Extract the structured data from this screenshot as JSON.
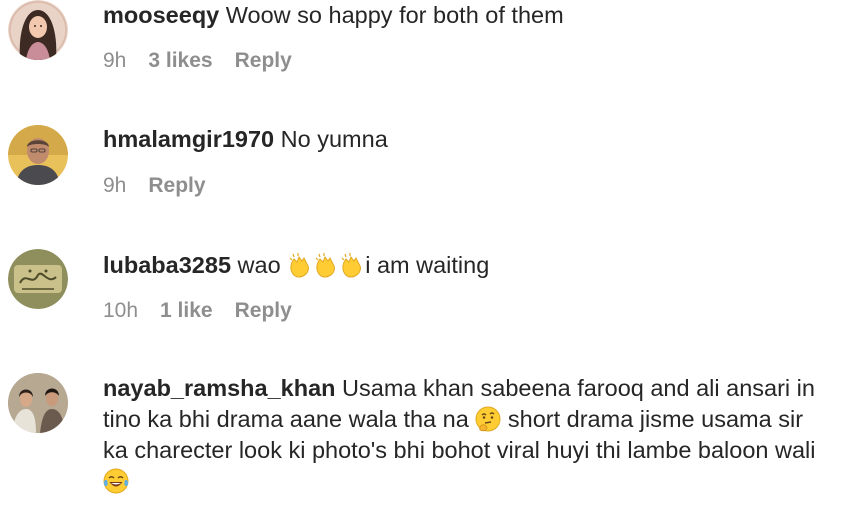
{
  "comments": [
    {
      "username": "mooseeqy",
      "text": "Woow so happy for both of them",
      "time": "9h",
      "likes": "3 likes",
      "reply": "Reply"
    },
    {
      "username": "hmalamgir1970",
      "text": "No yumna",
      "time": "9h",
      "reply": "Reply"
    },
    {
      "username": "lubaba3285",
      "text_before": "wao",
      "text_after": "i am waiting",
      "emoji": [
        "clapping-hands",
        "clapping-hands",
        "clapping-hands"
      ],
      "time": "10h",
      "likes": "1 like",
      "reply": "Reply"
    },
    {
      "username": "nayab_ramsha_khan",
      "text_part1": "Usama khan sabeena farooq and ali ansari in tino ka bhi drama aane wala tha na",
      "text_part2": "short drama jisme usama sir ka charecter look ki photo's bhi bohot viral huyi thi lambe baloon wali",
      "emoji": [
        "thinking-face",
        "tears-of-joy"
      ]
    }
  ],
  "colors": {
    "text_primary": "#262626",
    "text_secondary": "#8e8e8e",
    "emoji_yellow": "#FFCC33"
  }
}
